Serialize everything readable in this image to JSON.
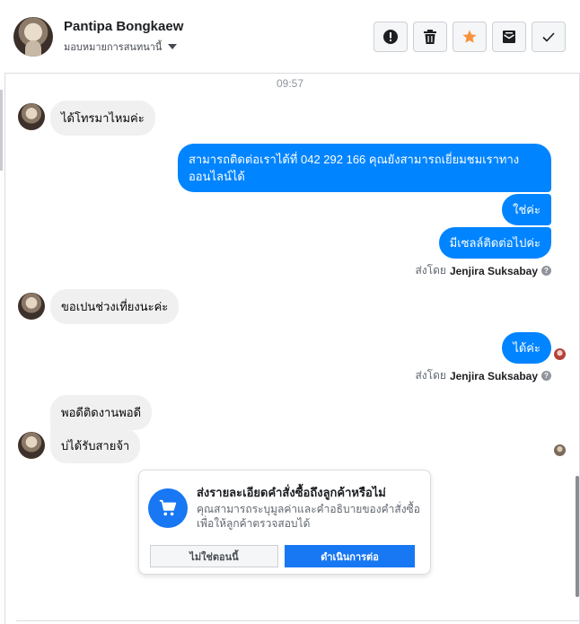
{
  "header": {
    "contact_name": "Pantipa Bongkaew",
    "assign_label": "มอบหมายการสนทนานี้",
    "actions": [
      {
        "icon": "alert-icon",
        "label": "spam"
      },
      {
        "icon": "trash-icon",
        "label": "delete"
      },
      {
        "icon": "star-icon",
        "label": "follow up"
      },
      {
        "icon": "mark-unread-icon",
        "label": "mark unread"
      },
      {
        "icon": "check-icon",
        "label": "done"
      }
    ]
  },
  "chat": {
    "timestamp": "09:57",
    "messages": [
      {
        "side": "in",
        "text": "ได้โทรมาไหมค่ะ"
      },
      {
        "side": "out",
        "text": "สามารถติดต่อเราได้ที่ 042 292 166 คุณยังสามารถเยี่ยมชมเราทาง ออนไลน์ได้"
      },
      {
        "side": "out",
        "text": "ใช่ค่ะ"
      },
      {
        "side": "out",
        "text": "มีเซลล์ติดต่อไปค่ะ"
      },
      {
        "side": "in",
        "text": "ขอเปนช่วงเที่ยงนะค่ะ"
      },
      {
        "side": "out",
        "text": "ได้ค่ะ"
      },
      {
        "side": "in",
        "text": "พอดีติดงานพอดี"
      },
      {
        "side": "in",
        "text": "บ่ได้รับสายจ้า"
      }
    ],
    "sent_by_prefix": "ส่งโดย",
    "sent_by_name": "Jenjira Suksabay",
    "help_glyph": "?"
  },
  "card": {
    "icon": "shopping-cart-icon",
    "title": "ส่งรายละเอียดคำสั่งซื้อถึงลูกค้าหรือไม่",
    "body": "คุณสามารถระบุมูลค่าและคำอธิบายของคำสั่งซื้อเพื่อให้ลูกค้าตรวจสอบได้",
    "secondary_label": "ไม่ใช่ตอนนี้",
    "primary_label": "ดำเนินการต่อ"
  },
  "colors": {
    "accent": "#0084ff",
    "primary_button": "#1877f2",
    "incoming_bubble": "#f1f0f0",
    "star": "#f7923b"
  }
}
